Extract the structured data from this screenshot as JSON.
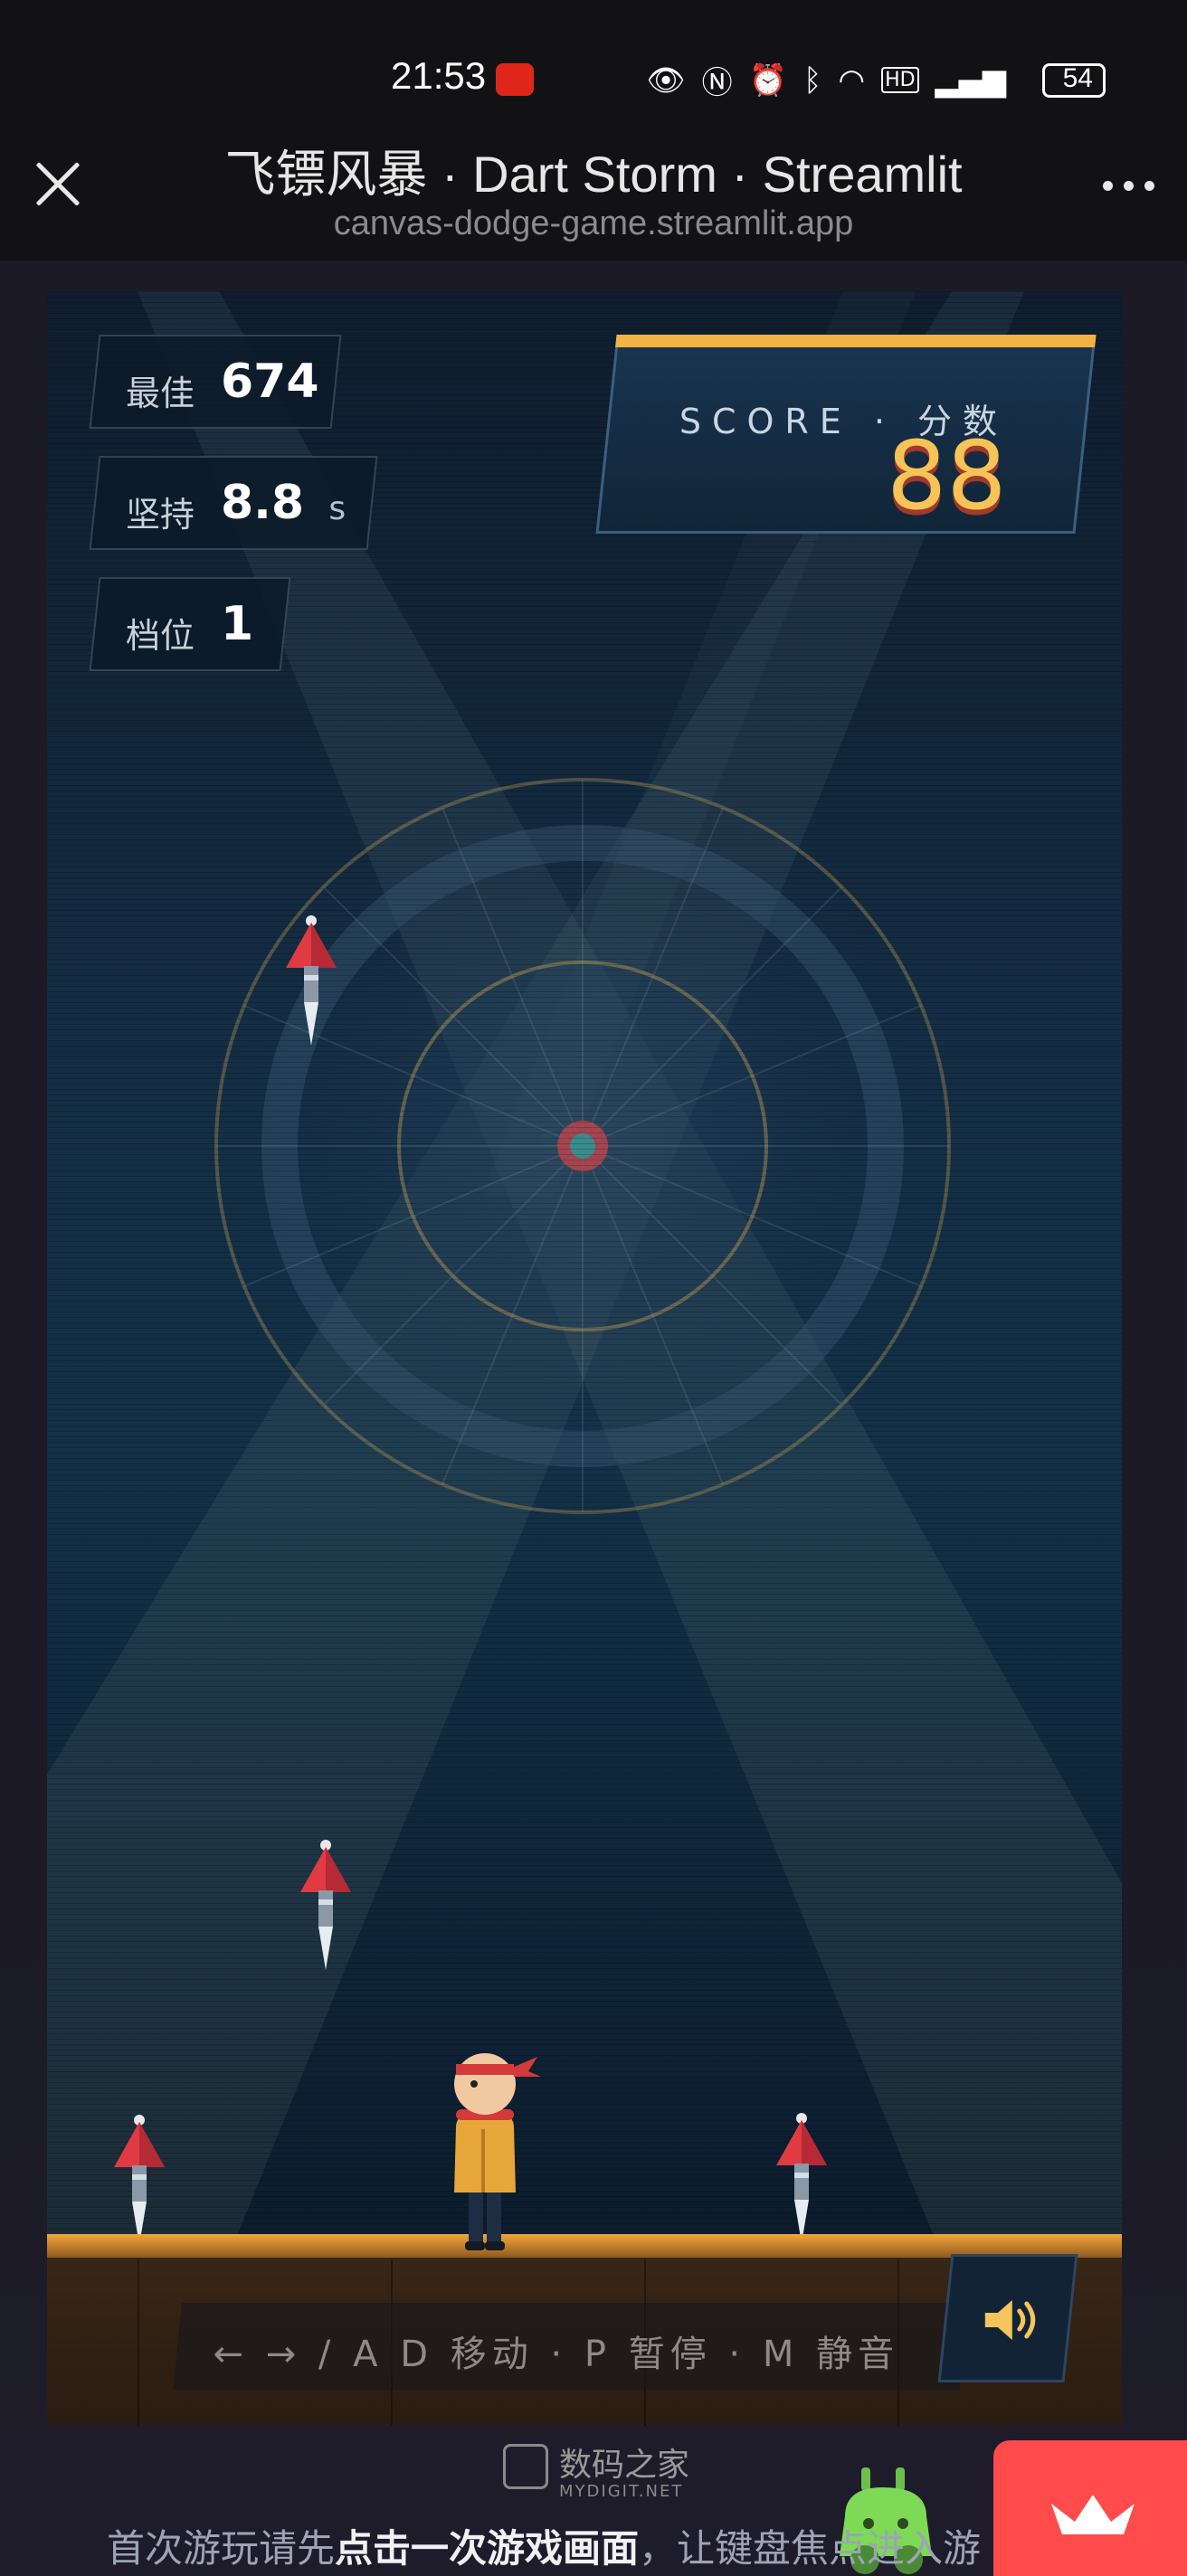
{
  "status_bar": {
    "time": "21:53",
    "battery": "54",
    "icons": [
      "eye-icon",
      "nfc-icon",
      "alarm-icon",
      "bluetooth-icon",
      "wifi-icon",
      "hd-icon",
      "signal-icon"
    ]
  },
  "titlebar": {
    "title": "飞镖风暴 · Dart Storm · Streamlit",
    "url": "canvas-dodge-game.streamlit.app"
  },
  "hud": {
    "best_label": "最佳",
    "best_value": "674",
    "survive_label": "坚持",
    "survive_value": "8.8",
    "survive_unit": "s",
    "level_label": "档位",
    "level_value": "1"
  },
  "score": {
    "label": "SCORE · 分数",
    "value": "88"
  },
  "controls_hint": "← → / A D 移动 · P 暂停 · M 静音",
  "sound_button": "volume-icon",
  "watermark": {
    "name": "数码之家",
    "domain": "MYDIGIT.NET"
  },
  "bottom_hint": {
    "before": "首次游玩请先",
    "bold": "点击一次游戏画面",
    "after": "，让键盘焦点进入游"
  },
  "colors": {
    "accent_gold": "#f2b441",
    "score_text": "#f6c357",
    "dart_red": "#e03a42",
    "streamlit_red": "#ff4b4b"
  }
}
